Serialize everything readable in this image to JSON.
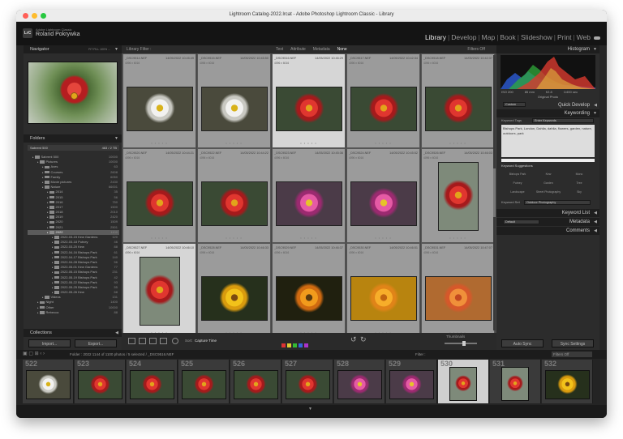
{
  "window": {
    "title": "Lightroom Catalog-2022.lrcat - Adobe Photoshop Lightroom Classic - Library",
    "traffic_colors": [
      "#ff5f57",
      "#febc2e",
      "#28c840"
    ]
  },
  "identity": {
    "logo_text": "LrC",
    "product": "Adobe Lightroom Classic",
    "owner": "Roland Pokrywka"
  },
  "modules": {
    "items": [
      "Library",
      "Develop",
      "Map",
      "Book",
      "Slideshow",
      "Print",
      "Web"
    ],
    "active": "Library"
  },
  "left_panel": {
    "navigator_title": "Navigator",
    "navigator_zoom": "FIT  FILL  100%  ...",
    "folders_title": "Folders",
    "volume": {
      "label": "Sabrent 500",
      "count": "463 / 2 TB"
    },
    "tree": [
      {
        "label": "Sabrent 500",
        "count": "10000",
        "indent": 1,
        "sel": false
      },
      {
        "label": "Pictures",
        "count": "10000",
        "indent": 2,
        "sel": false
      },
      {
        "label": "Aves",
        "count": "63",
        "indent": 3,
        "sel": false
      },
      {
        "label": "Courses",
        "count": "2608",
        "indent": 3,
        "sel": false
      },
      {
        "label": "Family",
        "count": "6050",
        "indent": 3,
        "sel": false
      },
      {
        "label": "Movie pictures",
        "count": "2430",
        "indent": 3,
        "sel": false
      },
      {
        "label": "Nature",
        "count": "66001",
        "indent": 3,
        "sel": false
      },
      {
        "label": "2014",
        "count": "35",
        "indent": 4,
        "sel": false
      },
      {
        "label": "2015",
        "count": "56",
        "indent": 4,
        "sel": false
      },
      {
        "label": "2016",
        "count": "750",
        "indent": 4,
        "sel": false
      },
      {
        "label": "2017",
        "count": "1500",
        "indent": 4,
        "sel": false
      },
      {
        "label": "2018",
        "count": "2010",
        "indent": 4,
        "sel": false
      },
      {
        "label": "2019",
        "count": "2420",
        "indent": 4,
        "sel": false
      },
      {
        "label": "2020",
        "count": "1509",
        "indent": 4,
        "sel": false
      },
      {
        "label": "2021",
        "count": "2501",
        "indent": 4,
        "sel": false
      },
      {
        "label": "2022",
        "count": "1100",
        "indent": 4,
        "sel": true
      },
      {
        "label": "2022-03-15 Kew Gardens",
        "count": "120",
        "indent": 5,
        "sel": false
      },
      {
        "label": "2022-03-18 Putney",
        "count": "46",
        "indent": 5,
        "sel": false
      },
      {
        "label": "2022-03-20 Kew",
        "count": "88",
        "indent": 5,
        "sel": false
      },
      {
        "label": "2022-04-16 Bishops Park",
        "count": "61",
        "indent": 5,
        "sel": false
      },
      {
        "label": "2022-04-17 Bishops Park",
        "count": "140",
        "indent": 5,
        "sel": false
      },
      {
        "label": "2022-04-28 Bishops Park",
        "count": "56",
        "indent": 5,
        "sel": false
      },
      {
        "label": "2022-05-01 Kew Gardens",
        "count": "77",
        "indent": 5,
        "sel": false
      },
      {
        "label": "2022-05-15 Bishops Park",
        "count": "231",
        "indent": 5,
        "sel": false
      },
      {
        "label": "2022-05-19 Bishops Park",
        "count": "42",
        "indent": 5,
        "sel": false
      },
      {
        "label": "2022-05-22 Bishops Park",
        "count": "93",
        "indent": 5,
        "sel": false
      },
      {
        "label": "2022-05-25 Bishops Park",
        "count": "55",
        "indent": 5,
        "sel": false
      },
      {
        "label": "2022-05-26 Kew",
        "count": "68",
        "indent": 5,
        "sel": false
      },
      {
        "label": "Videos",
        "count": "131",
        "indent": 3,
        "sel": false
      },
      {
        "label": "Night",
        "count": "1400",
        "indent": 2,
        "sel": false
      },
      {
        "label": "Other",
        "count": "10000",
        "indent": 2,
        "sel": false
      },
      {
        "label": "Rebecca",
        "count": "88",
        "indent": 2,
        "sel": false
      }
    ],
    "collections_title": "Collections",
    "import_label": "Import...",
    "export_label": "Export..."
  },
  "filter_bar": {
    "title": "Library Filter :",
    "tabs": [
      "Text",
      "Attribute",
      "Metadata",
      "None"
    ],
    "active": "None",
    "preset": "Filters Off"
  },
  "grid": {
    "rows": [
      [
        {
          "name": "_DSC9514.NEF",
          "date": "14/05/2022 10:45:49",
          "info": "4096 x 6016",
          "flower": "white",
          "sel": false
        },
        {
          "name": "_DSC9515.NEF",
          "date": "14/05/2022 10:45:50",
          "info": "4096 x 6016",
          "flower": "white",
          "sel": false
        },
        {
          "name": "_DSC9516.NEF",
          "date": "14/05/2022 10:46:29",
          "info": "4096 x 6016",
          "flower": "red",
          "sel": true
        },
        {
          "name": "_DSC9517.NEF",
          "date": "14/05/2022 10:42:34",
          "info": "4096 x 6016",
          "flower": "red",
          "sel": false
        },
        {
          "name": "_DSC9518.NEF",
          "date": "14/05/2022 10:42:37",
          "info": "4096 x 6016",
          "flower": "red",
          "sel": false
        }
      ],
      [
        {
          "name": "_DSC9520.NEF",
          "date": "14/05/2022 10:44:21",
          "info": "4096 x 6016",
          "flower": "red",
          "sel": false
        },
        {
          "name": "_DSC9522.NEF",
          "date": "14/05/2022 10:44:22",
          "info": "4096 x 6016",
          "flower": "red",
          "sel": false
        },
        {
          "name": "_DSC9523.NEF",
          "date": "14/05/2022 10:45:36",
          "info": "4096 x 6016",
          "flower": "pink",
          "sel": false
        },
        {
          "name": "_DSC9524.NEF",
          "date": "14/05/2022 10:45:52",
          "info": "4096 x 6016",
          "flower": "pink",
          "sel": false
        },
        {
          "name": "_DSC9526.NEF",
          "date": "14/05/2022 10:46:03",
          "info": "4096 x 6016",
          "flower": "red-portrait",
          "sel": false
        }
      ],
      [
        {
          "name": "_DSC9527.NEF",
          "date": "14/05/2022 10:46:10",
          "info": "4096 x 6016",
          "flower": "red-portrait",
          "sel": true
        },
        {
          "name": "_DSC9528.NEF",
          "date": "14/05/2022 10:46:33",
          "info": "4096 x 6016",
          "flower": "yellow",
          "sel": false
        },
        {
          "name": "_DSC9529.NEF",
          "date": "14/05/2022 10:46:37",
          "info": "4096 x 6016",
          "flower": "orange",
          "sel": false
        },
        {
          "name": "_DSC9530.NEF",
          "date": "14/05/2022 10:46:51",
          "info": "4096 x 6016",
          "flower": "orange-big",
          "sel": false
        },
        {
          "name": "_DSC9531.NEF",
          "date": "14/05/2022 10:47:07",
          "info": "4096 x 6016",
          "flower": "dahlia",
          "sel": false
        }
      ]
    ],
    "rating_dots": "• • • • •"
  },
  "toolbar": {
    "sort_label": "Sort:",
    "sort_value": "Capture Time",
    "thumbnails_label": "Thumbnails"
  },
  "right_panel": {
    "histogram_title": "Histogram",
    "hist_info": [
      "ISO 200",
      "85 mm",
      "f/2.8",
      "1/400 sec"
    ],
    "original_photo": "Original Photo",
    "quick_develop_title": "Quick Develop",
    "saved_preset": "Custom",
    "keywording_title": "Keywording",
    "keyword_tags_label": "Keyword Tags",
    "keyword_tags_mode": "Enter Keywords",
    "keywords_text": "Bishops Park, London, Dahlia, dahlia, flowers, garden, nature, outdoors, park",
    "suggestions_title": "Keyword Suggestions",
    "suggestions": [
      "Bishops Park",
      "Kew",
      "Mono",
      "Putney",
      "Garden",
      "Tree",
      "Landscape",
      "Street Photography",
      "Sky"
    ],
    "keyword_set_label": "Keyword Set",
    "keyword_set_value": "Outdoor Photography",
    "keyword_list_title": "Keyword List",
    "metadata_title": "Metadata",
    "metadata_preset": "Default",
    "comments_title": "Comments",
    "auto_sync_label": "Auto Sync",
    "sync_settings_label": "Sync Settings"
  },
  "filmstrip_bar": {
    "info": "Folder : 2022     1144 of 1100 photos / 5 selected / _DSC9516.NEF",
    "filter_label": "Filter :",
    "filter_value": "Filters Off"
  },
  "filmstrip": [
    {
      "num": "522",
      "flower": "white",
      "sel": false
    },
    {
      "num": "523",
      "flower": "red",
      "sel": false
    },
    {
      "num": "524",
      "flower": "red",
      "sel": false
    },
    {
      "num": "525",
      "flower": "red",
      "sel": false
    },
    {
      "num": "526",
      "flower": "red",
      "sel": false
    },
    {
      "num": "527",
      "flower": "red",
      "sel": false
    },
    {
      "num": "528",
      "flower": "pink",
      "sel": false
    },
    {
      "num": "529",
      "flower": "pink",
      "sel": false
    },
    {
      "num": "530",
      "flower": "red-portrait",
      "sel": true
    },
    {
      "num": "531",
      "flower": "red-portrait",
      "sel": false
    },
    {
      "num": "532",
      "flower": "yellow",
      "sel": false
    }
  ]
}
